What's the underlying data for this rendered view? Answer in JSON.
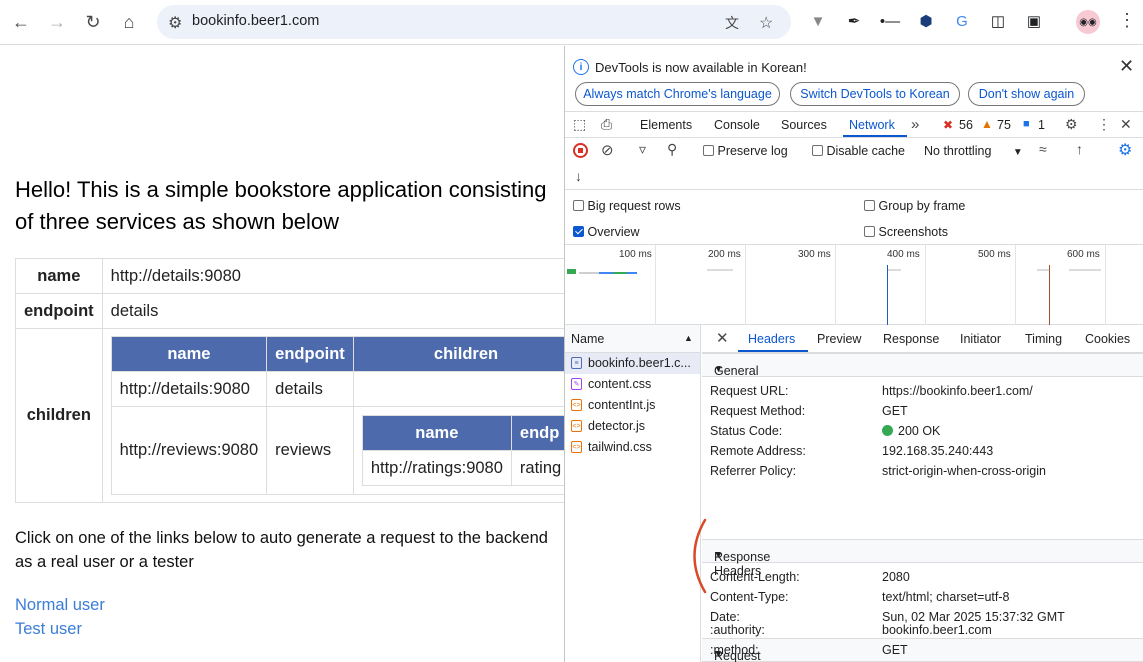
{
  "browser": {
    "url": "bookinfo.beer1.com"
  },
  "page": {
    "title": "Hello! This is a simple bookstore application consisting of three services as shown below",
    "table": {
      "name_key": "name",
      "name_value": "http://details:9080",
      "endpoint_key": "endpoint",
      "endpoint_value": "details",
      "children_key": "children",
      "children_headers": [
        "name",
        "endpoint",
        "children"
      ],
      "child_rows": [
        {
          "name": "http://details:9080",
          "endpoint": "details"
        },
        {
          "name": "http://reviews:9080",
          "endpoint": "reviews"
        }
      ],
      "nested_headers": [
        "name",
        "endp"
      ],
      "nested_row": {
        "name": "http://ratings:9080",
        "endpoint": "rating"
      }
    },
    "paragraph": "Click on one of the links below to auto generate a request to the backend as a real user or a tester",
    "links": [
      "Normal user",
      "Test user"
    ]
  },
  "devtools": {
    "infobar": {
      "message": "DevTools is now available in Korean!",
      "buttons": [
        "Always match Chrome's language",
        "Switch DevTools to Korean",
        "Don't show again"
      ]
    },
    "tabs": [
      "Elements",
      "Console",
      "Sources",
      "Network"
    ],
    "active_tab": "Network",
    "counts": {
      "errors": "56",
      "warnings": "75",
      "messages": "1"
    },
    "network_toolbar": {
      "preserve_log": "Preserve log",
      "disable_cache": "Disable cache",
      "throttling": "No throttling"
    },
    "options": {
      "big_request_rows": "Big request rows",
      "group_by_frame": "Group by frame",
      "overview": "Overview",
      "screenshots": "Screenshots"
    },
    "timeline_ticks": [
      "100 ms",
      "200 ms",
      "300 ms",
      "400 ms",
      "500 ms",
      "600 ms"
    ],
    "request_list": {
      "header": "Name",
      "items": [
        "bookinfo.beer1.c...",
        "content.css",
        "contentInt.js",
        "detector.js",
        "tailwind.css"
      ]
    },
    "detail_tabs": [
      "Headers",
      "Preview",
      "Response",
      "Initiator",
      "Timing",
      "Cookies"
    ],
    "general": {
      "title": "General",
      "rows": [
        {
          "k": "Request URL:",
          "v": "https://bookinfo.beer1.com/"
        },
        {
          "k": "Request Method:",
          "v": "GET"
        },
        {
          "k": "Status Code:",
          "v": "200 OK"
        },
        {
          "k": "Remote Address:",
          "v": "192.168.35.240:443"
        },
        {
          "k": "Referrer Policy:",
          "v": "strict-origin-when-cross-origin"
        }
      ]
    },
    "response_headers": {
      "title": "Response Headers",
      "rows": [
        {
          "k": "Content-Length:",
          "v": "2080"
        },
        {
          "k": "Content-Type:",
          "v": "text/html; charset=utf-8"
        },
        {
          "k": "Date:",
          "v": "Sun, 02 Mar 2025 15:37:32 GMT"
        }
      ]
    },
    "request_headers": {
      "title": "Request Headers",
      "rows": [
        {
          "k": ":authority:",
          "v": "bookinfo.beer1.com"
        },
        {
          "k": ":method:",
          "v": "GET"
        }
      ]
    }
  },
  "colors": {
    "accent": "#0b57d0",
    "table_header": "#4d6bac",
    "link": "#3b7dd8",
    "annotation": "#d84a25"
  }
}
